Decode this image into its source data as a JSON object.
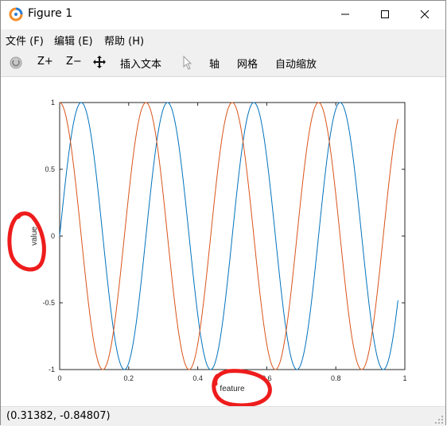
{
  "window": {
    "title": "Figure 1"
  },
  "menu": [
    {
      "label": "文件",
      "key": "(F)"
    },
    {
      "label": "编辑",
      "key": "(E)"
    },
    {
      "label": "帮助",
      "key": "(H)"
    }
  ],
  "toolbar": {
    "zoom_in": "Z+",
    "zoom_out": "Z−",
    "insert_text": "插入文本",
    "axis": "轴",
    "grid": "网格",
    "autoscale": "自动缩放"
  },
  "status": {
    "coords": "(0.31382, -0.84807)"
  },
  "chart_data": {
    "type": "line",
    "xlabel": "feature",
    "ylabel": "value",
    "xlim": [
      0,
      1
    ],
    "ylim": [
      -1,
      1
    ],
    "xticks": [
      "0",
      "0.2",
      "0.4",
      "0.6",
      "0.8",
      "1"
    ],
    "yticks": [
      "1",
      "0.5",
      "0",
      "-0.5",
      "-1"
    ],
    "grid": false,
    "series": [
      {
        "function": "sin(2*pi*4*x)",
        "x_range": [
          0,
          0.98
        ],
        "color": "#0072bd"
      },
      {
        "function": "cos(2*pi*4*x)",
        "x_range": [
          0,
          0.98
        ],
        "color": "#d95319"
      }
    ],
    "annotations": [
      "red hand-drawn circle around ylabel",
      "red hand-drawn circle around xlabel"
    ]
  }
}
